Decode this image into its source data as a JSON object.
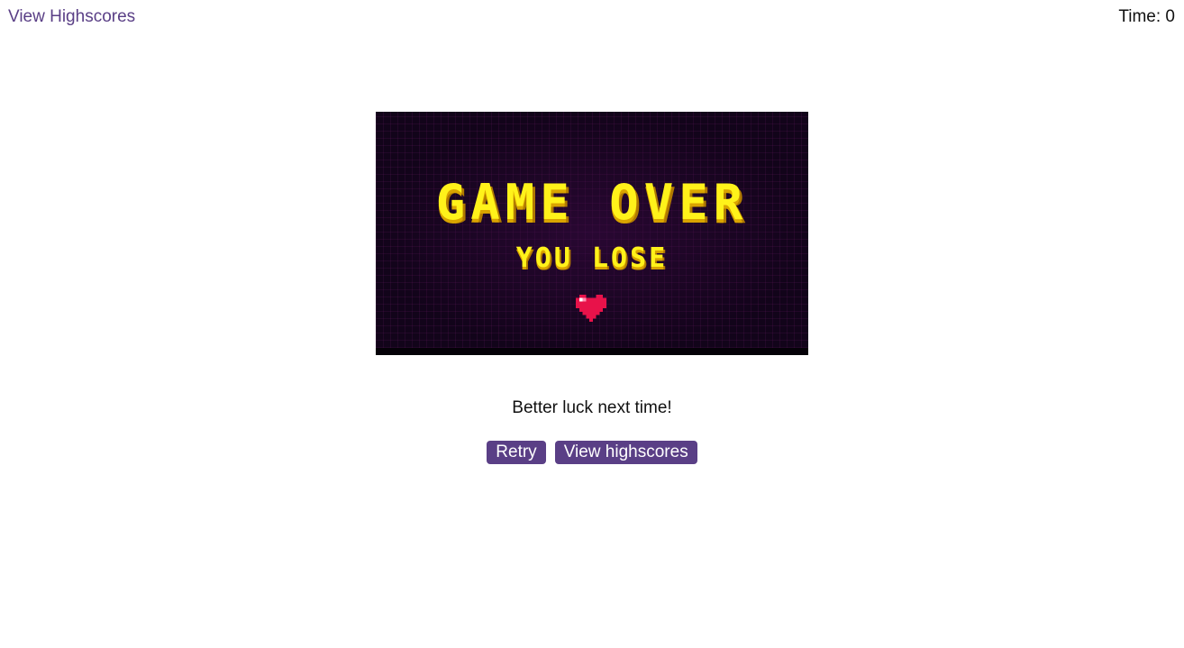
{
  "header": {
    "highscores_link": "View Highscores",
    "timer_label": "Time: 0"
  },
  "banner": {
    "title": "GAME OVER",
    "subtitle": "YOU LOSE",
    "icon": "heart-icon"
  },
  "result": {
    "message": "Better luck next time!"
  },
  "actions": {
    "retry_label": "Retry",
    "view_highscores_label": "View highscores"
  },
  "colors": {
    "accent": "#5a3f86",
    "banner_background": "#12041a",
    "banner_text": "#fff21a",
    "heart": "#e8124a"
  }
}
